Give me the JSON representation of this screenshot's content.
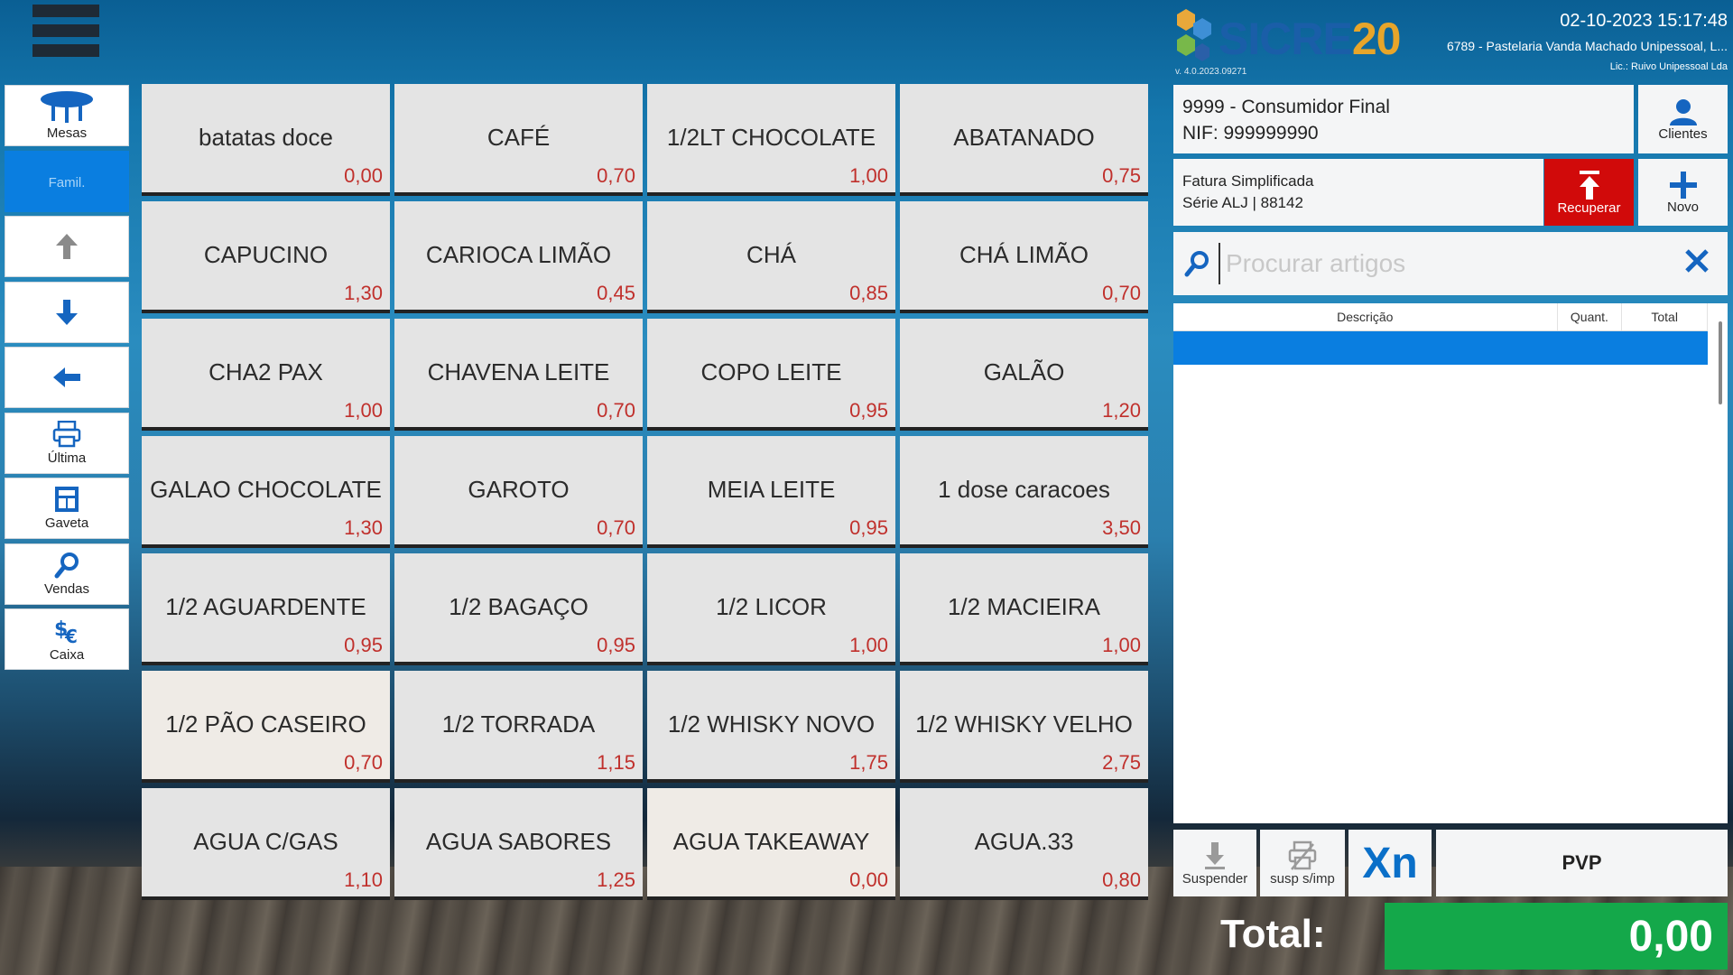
{
  "sidebar": {
    "items": [
      {
        "label": "Mesas",
        "icon": "table-icon"
      },
      {
        "label": "Famil.",
        "icon": ""
      },
      {
        "label": "",
        "icon": "arrow-up-icon"
      },
      {
        "label": "",
        "icon": "arrow-down-icon"
      },
      {
        "label": "",
        "icon": "arrow-left-icon"
      },
      {
        "label": "Última",
        "icon": "printer-icon"
      },
      {
        "label": "Gaveta",
        "icon": "drawer-icon"
      },
      {
        "label": "Vendas",
        "icon": "search-icon"
      },
      {
        "label": "Caixa",
        "icon": "cash-icon"
      }
    ]
  },
  "products": [
    {
      "name": "batatas doce",
      "price": "0,00"
    },
    {
      "name": "CAFÉ",
      "price": "0,70"
    },
    {
      "name": "1/2LT CHOCOLATE",
      "price": "1,00"
    },
    {
      "name": "ABATANADO",
      "price": "0,75"
    },
    {
      "name": "CAPUCINO",
      "price": "1,30"
    },
    {
      "name": "CARIOCA LIMÃO",
      "price": "0,45"
    },
    {
      "name": "CHÁ",
      "price": "0,85"
    },
    {
      "name": "CHÁ LIMÃO",
      "price": "0,70"
    },
    {
      "name": "CHA2 PAX",
      "price": "1,00"
    },
    {
      "name": "CHAVENA LEITE",
      "price": "0,70"
    },
    {
      "name": "COPO LEITE",
      "price": "0,95"
    },
    {
      "name": "GALÃO",
      "price": "1,20"
    },
    {
      "name": "GALAO CHOCOLATE",
      "price": "1,30"
    },
    {
      "name": "GAROTO",
      "price": "0,70"
    },
    {
      "name": "MEIA LEITE",
      "price": "0,95"
    },
    {
      "name": "1 dose caracoes",
      "price": "3,50"
    },
    {
      "name": "1/2 AGUARDENTE",
      "price": "0,95"
    },
    {
      "name": "1/2 BAGAÇO",
      "price": "0,95"
    },
    {
      "name": "1/2 LICOR",
      "price": "1,00"
    },
    {
      "name": "1/2 MACIEIRA",
      "price": "1,00"
    },
    {
      "name": "1/2 PÃO CASEIRO",
      "price": "0,70"
    },
    {
      "name": "1/2 TORRADA",
      "price": "1,15"
    },
    {
      "name": "1/2 WHISKY NOVO",
      "price": "1,75"
    },
    {
      "name": "1/2 WHISKY VELHO",
      "price": "2,75"
    },
    {
      "name": "AGUA C/GAS",
      "price": "1,10"
    },
    {
      "name": "AGUA SABORES",
      "price": "1,25"
    },
    {
      "name": "AGUA TAKEAWAY",
      "price": "0,00"
    },
    {
      "name": "AGUA.33",
      "price": "0,80"
    }
  ],
  "header": {
    "logo_text": "SICRE",
    "logo_num": "20",
    "version": "v. 4.0.2023.09271",
    "datetime": "02-10-2023  15:17:48",
    "company": "6789 - Pastelaria Vanda Machado Unipessoal, L...",
    "licence": "Lic.: Ruivo Unipessoal Lda"
  },
  "client": {
    "line1": "9999 - Consumidor Final",
    "line2": "NIF: 999999990",
    "button_label": "Clientes"
  },
  "document": {
    "type": "Fatura Simplificada",
    "series": "Série ALJ | 88142",
    "recover_label": "Recuperar",
    "new_label": "Novo"
  },
  "search": {
    "placeholder": "Procurar artigos"
  },
  "table": {
    "columns": [
      "Descrição",
      "Quant.",
      "Total"
    ]
  },
  "actions": {
    "suspend_label": "Suspender",
    "susp_print_label": "susp s/imp",
    "xn_label": "Xn",
    "pvp_label": "PVP"
  },
  "totals": {
    "label": "Total:",
    "value": "0,00"
  },
  "colors": {
    "accent": "#0a7ee0",
    "price": "#c0302c",
    "recover": "#d10a0a",
    "total": "#14a84a"
  }
}
